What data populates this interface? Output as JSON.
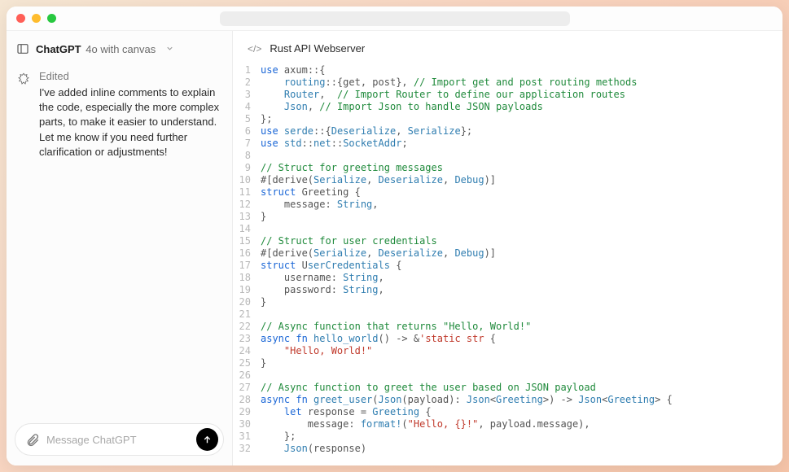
{
  "header": {
    "model_name": "ChatGPT",
    "model_variant": "4o with canvas"
  },
  "conversation": {
    "status": "Edited",
    "message": "I've added inline comments to explain the code, especially the more complex parts, to make it easier to understand. Let me know if you need further clarification or adjustments!"
  },
  "composer": {
    "placeholder": "Message ChatGPT"
  },
  "canvas": {
    "title": "Rust API Webserver",
    "code_lines": [
      [
        [
          "kw",
          "use "
        ],
        [
          "ident",
          "axum"
        ],
        [
          "punct",
          "::{"
        ]
      ],
      [
        [
          "ident",
          "    "
        ],
        [
          "path",
          "routing"
        ],
        [
          "punct",
          "::{"
        ],
        [
          "ident",
          "get, post"
        ],
        [
          "punct",
          "}, "
        ],
        [
          "cmt",
          "// Import get and post routing methods"
        ]
      ],
      [
        [
          "ident",
          "    "
        ],
        [
          "path",
          "Router"
        ],
        [
          "punct",
          ",  "
        ],
        [
          "cmt",
          "// Import Router to define our application routes"
        ]
      ],
      [
        [
          "ident",
          "    "
        ],
        [
          "path",
          "Json"
        ],
        [
          "punct",
          ", "
        ],
        [
          "cmt",
          "// Import Json to handle JSON payloads"
        ]
      ],
      [
        [
          "punct",
          "};"
        ]
      ],
      [
        [
          "kw",
          "use "
        ],
        [
          "path",
          "serde"
        ],
        [
          "punct",
          "::{"
        ],
        [
          "type",
          "Deserialize"
        ],
        [
          "punct",
          ", "
        ],
        [
          "type",
          "Serialize"
        ],
        [
          "punct",
          "};"
        ]
      ],
      [
        [
          "kw",
          "use "
        ],
        [
          "path",
          "std"
        ],
        [
          "punct",
          "::"
        ],
        [
          "path",
          "net"
        ],
        [
          "punct",
          "::"
        ],
        [
          "type",
          "SocketAddr"
        ],
        [
          "punct",
          ";"
        ]
      ],
      [
        [
          "ident",
          ""
        ]
      ],
      [
        [
          "cmt",
          "// Struct for greeting messages"
        ]
      ],
      [
        [
          "punct",
          "#[derive("
        ],
        [
          "type",
          "Serialize"
        ],
        [
          "punct",
          ", "
        ],
        [
          "type",
          "Deserialize"
        ],
        [
          "punct",
          ", "
        ],
        [
          "type",
          "Debug"
        ],
        [
          "punct",
          ")]"
        ]
      ],
      [
        [
          "kw",
          "struct "
        ],
        [
          "ident",
          "Greeting {"
        ]
      ],
      [
        [
          "ident",
          "    message: "
        ],
        [
          "type",
          "String"
        ],
        [
          "punct",
          ","
        ]
      ],
      [
        [
          "punct",
          "}"
        ]
      ],
      [
        [
          "ident",
          ""
        ]
      ],
      [
        [
          "cmt",
          "// Struct for user credentials"
        ]
      ],
      [
        [
          "punct",
          "#[derive("
        ],
        [
          "type",
          "Serialize"
        ],
        [
          "punct",
          ", "
        ],
        [
          "type",
          "Deserialize"
        ],
        [
          "punct",
          ", "
        ],
        [
          "type",
          "Debug"
        ],
        [
          "punct",
          ")]"
        ]
      ],
      [
        [
          "kw",
          "struct "
        ],
        [
          "ident",
          "U"
        ],
        [
          "type",
          "serCredentials"
        ],
        [
          "ident",
          " {"
        ]
      ],
      [
        [
          "ident",
          "    username: "
        ],
        [
          "type",
          "String"
        ],
        [
          "punct",
          ","
        ]
      ],
      [
        [
          "ident",
          "    password: "
        ],
        [
          "type",
          "String"
        ],
        [
          "punct",
          ","
        ]
      ],
      [
        [
          "punct",
          "}"
        ]
      ],
      [
        [
          "ident",
          ""
        ]
      ],
      [
        [
          "cmt",
          "// Async function that returns \"Hello, World!\""
        ]
      ],
      [
        [
          "kw",
          "async fn "
        ],
        [
          "fn",
          "hello_world"
        ],
        [
          "punct",
          "() -> &"
        ],
        [
          "str",
          "'static str"
        ],
        [
          "punct",
          " {"
        ]
      ],
      [
        [
          "ident",
          "    "
        ],
        [
          "str",
          "\"Hello, World!\""
        ]
      ],
      [
        [
          "punct",
          "}"
        ]
      ],
      [
        [
          "ident",
          ""
        ]
      ],
      [
        [
          "cmt",
          "// Async function to greet the user based on JSON payload"
        ]
      ],
      [
        [
          "kw",
          "async fn "
        ],
        [
          "fn",
          "greet_user"
        ],
        [
          "punct",
          "("
        ],
        [
          "type",
          "Json"
        ],
        [
          "punct",
          "(payload): "
        ],
        [
          "type",
          "Json"
        ],
        [
          "punct",
          "<"
        ],
        [
          "type",
          "Greeting"
        ],
        [
          "punct",
          ">) -> "
        ],
        [
          "type",
          "Json"
        ],
        [
          "punct",
          "<"
        ],
        [
          "type",
          "Greeting"
        ],
        [
          "punct",
          "> {"
        ]
      ],
      [
        [
          "ident",
          "    "
        ],
        [
          "kw",
          "let "
        ],
        [
          "ident",
          "response = "
        ],
        [
          "type",
          "Greeting"
        ],
        [
          "punct",
          " {"
        ]
      ],
      [
        [
          "ident",
          "        message: "
        ],
        [
          "fn",
          "format!"
        ],
        [
          "punct",
          "("
        ],
        [
          "str",
          "\"Hello, {}!\""
        ],
        [
          "punct",
          ", "
        ],
        [
          "ident",
          "payload"
        ],
        [
          "punct",
          ".message),"
        ]
      ],
      [
        [
          "ident",
          "    };"
        ]
      ],
      [
        [
          "ident",
          "    "
        ],
        [
          "type",
          "Json"
        ],
        [
          "punct",
          "(response)"
        ]
      ]
    ]
  }
}
